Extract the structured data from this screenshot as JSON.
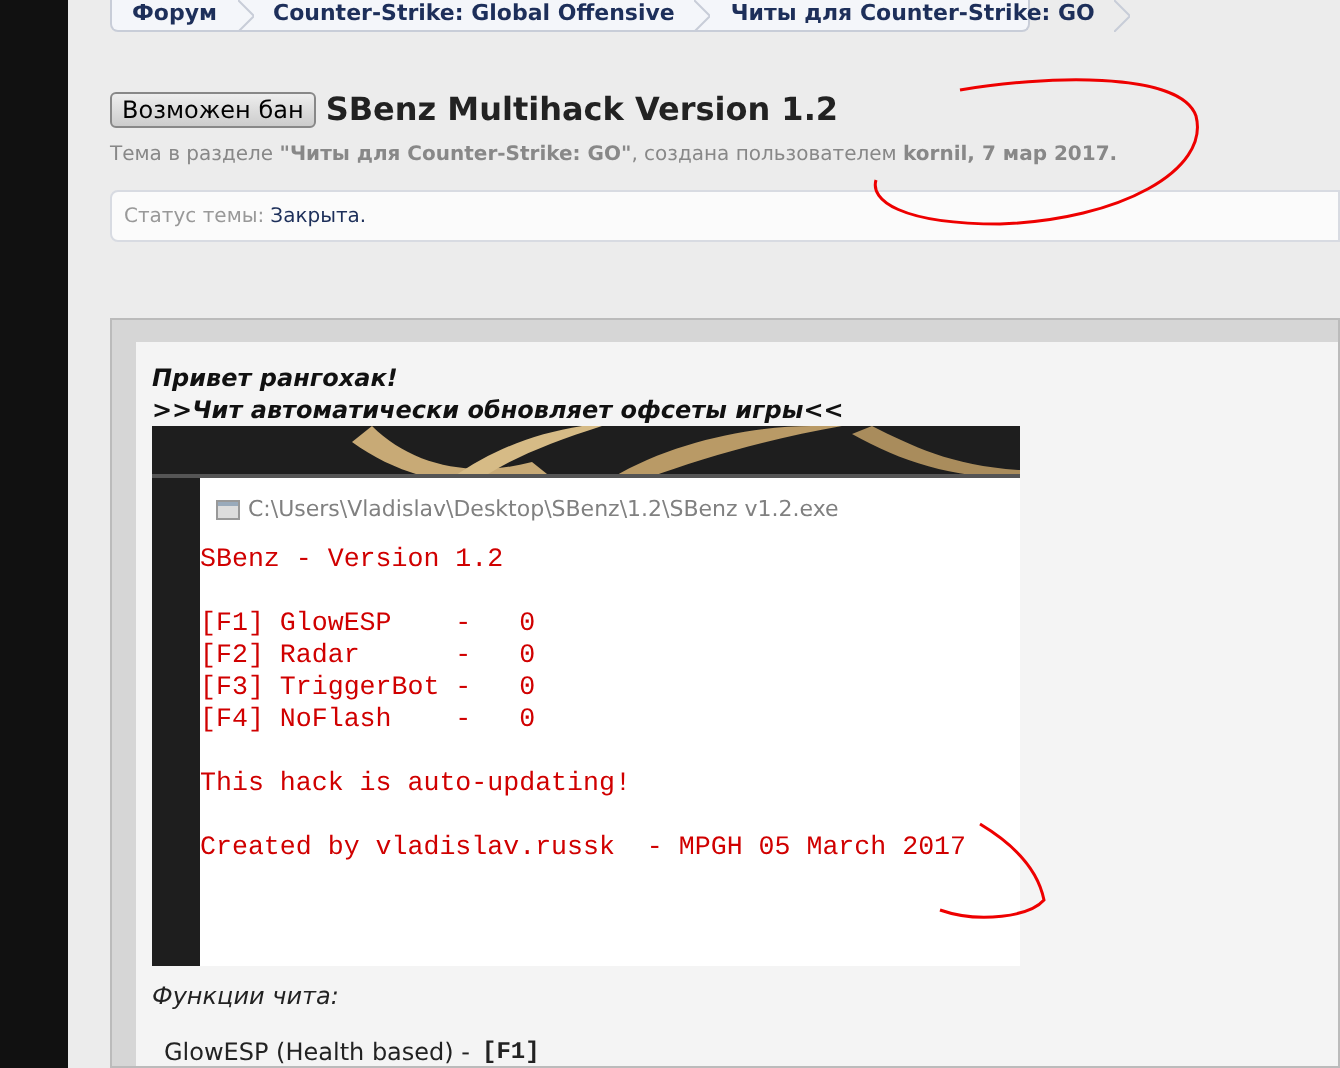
{
  "breadcrumbs": [
    {
      "label": "Форум"
    },
    {
      "label": "Counter-Strike: Global Offensive"
    },
    {
      "label": "Читы для Counter-Strike: GO"
    }
  ],
  "thread": {
    "prefix": "Возможен бан",
    "title": "SBenz Multihack Version 1.2",
    "meta": "Тема в разделе **\"Читы для Counter-Strike: GO\"**, создана пользователем **kornil, 7 мар 2017.**"
  },
  "status": {
    "label": "Статус темы:",
    "value": "Закрыта."
  },
  "post": {
    "lines": [
      "Привет рангохак!",
      ">>Чит автоматически обновляет офсеты игры<<"
    ],
    "console": {
      "path": "C:\\Users\\Vladislav\\Desktop\\SBenz\\1.2\\SBenz v1.2.exe",
      "blocks": [
        [
          "SBenz - Version 1.2"
        ],
        [
          "[F1] GlowESP    -   0",
          "[F2] Radar      -   0",
          "[F3] TriggerBot -   0",
          "[F4] NoFlash    -   0"
        ],
        [
          "This hack is auto-updating!"
        ],
        [
          "Created by vladislav.russk  - MPGH 05 March 2017"
        ]
      ]
    },
    "features_heading": "Функции чита:",
    "features": [
      {
        "name": "GlowESP (Health based) -",
        "key": "[F1]"
      }
    ]
  }
}
